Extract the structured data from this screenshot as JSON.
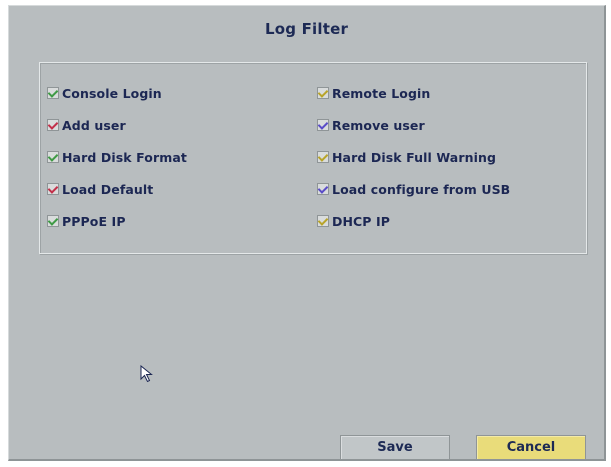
{
  "dialog": {
    "title": "Log Filter"
  },
  "options": {
    "console_login": {
      "label": "Console Login",
      "checked": true,
      "tick_color": "#3f9a45"
    },
    "remote_login": {
      "label": "Remote Login",
      "checked": true,
      "tick_color": "#b8a42a"
    },
    "add_user": {
      "label": "Add user",
      "checked": true,
      "tick_color": "#c2304a"
    },
    "remove_user": {
      "label": "Remove user",
      "checked": true,
      "tick_color": "#5a4cc7"
    },
    "hard_disk_format": {
      "label": "Hard Disk Format",
      "checked": true,
      "tick_color": "#3f9a45"
    },
    "hard_disk_full_warning": {
      "label": "Hard Disk Full Warning",
      "checked": true,
      "tick_color": "#b8a42a"
    },
    "load_default": {
      "label": "Load Default",
      "checked": true,
      "tick_color": "#c2304a"
    },
    "load_configure_from_usb": {
      "label": "Load configure from USB",
      "checked": true,
      "tick_color": "#5a4cc7"
    },
    "pppoe_ip": {
      "label": "PPPoE IP",
      "checked": true,
      "tick_color": "#3f9a45"
    },
    "dhcp_ip": {
      "label": "DHCP IP",
      "checked": true,
      "tick_color": "#b8a42a"
    }
  },
  "buttons": {
    "save_label": "Save",
    "cancel_label": "Cancel"
  },
  "colors": {
    "background": "#b8bdbf",
    "text": "#1c2753",
    "cancel_highlight": "#e9dc7a"
  }
}
